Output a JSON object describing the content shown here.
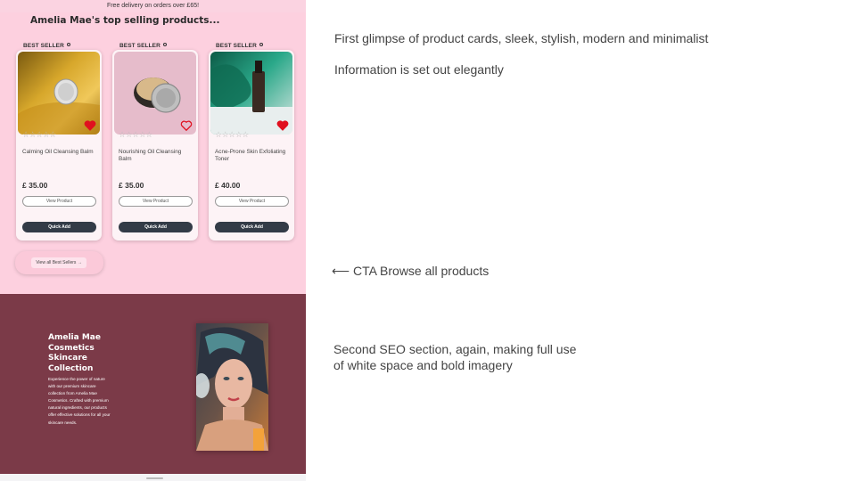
{
  "banner": {
    "text": "Free delivery on orders over £65!"
  },
  "section": {
    "title": "Amelia Mae's top selling products..."
  },
  "products": [
    {
      "badge": "BEST SELLER",
      "stars": "☆☆☆☆☆",
      "name": "Calming Oil Cleansing Balm",
      "price": "£ 35.00",
      "view": "View Product",
      "quick": "Quick Add"
    },
    {
      "badge": "BEST SELLER",
      "stars": "☆☆☆☆☆",
      "name": "Nourishing Oil Cleansing Balm",
      "price": "£ 35.00",
      "view": "View Product",
      "quick": "Quick Add"
    },
    {
      "badge": "BEST SELLER",
      "stars": "☆☆☆☆☆",
      "name": "Acne-Prone Skin Exfoliating Toner",
      "price": "£ 40.00",
      "view": "View Product",
      "quick": "Quick Add"
    }
  ],
  "cta": {
    "label": "View all Best Sellers →"
  },
  "seo": {
    "title": "Amelia Mae Cosmetics Skincare Collection",
    "body": "Experience the power of nature with our premium skincare collection from Amelia Mae Cosmetics. Crafted with premium natural ingredients, our products offer effective solutions for all your skincare needs."
  },
  "annotations": {
    "note1": "First glimpse of product cards, sleek, stylish, modern and minimalist",
    "note2": "Information is set out elegantly",
    "note3": "⟵ CTA Browse all products",
    "note4_line1": "Second SEO section, again, making full use",
    "note4_line2": "of white space and bold imagery"
  },
  "colors": {
    "pink": "#fdd0df",
    "maroon": "#7b3a48",
    "button_dark": "#333b47",
    "heart": "#e0101f"
  }
}
